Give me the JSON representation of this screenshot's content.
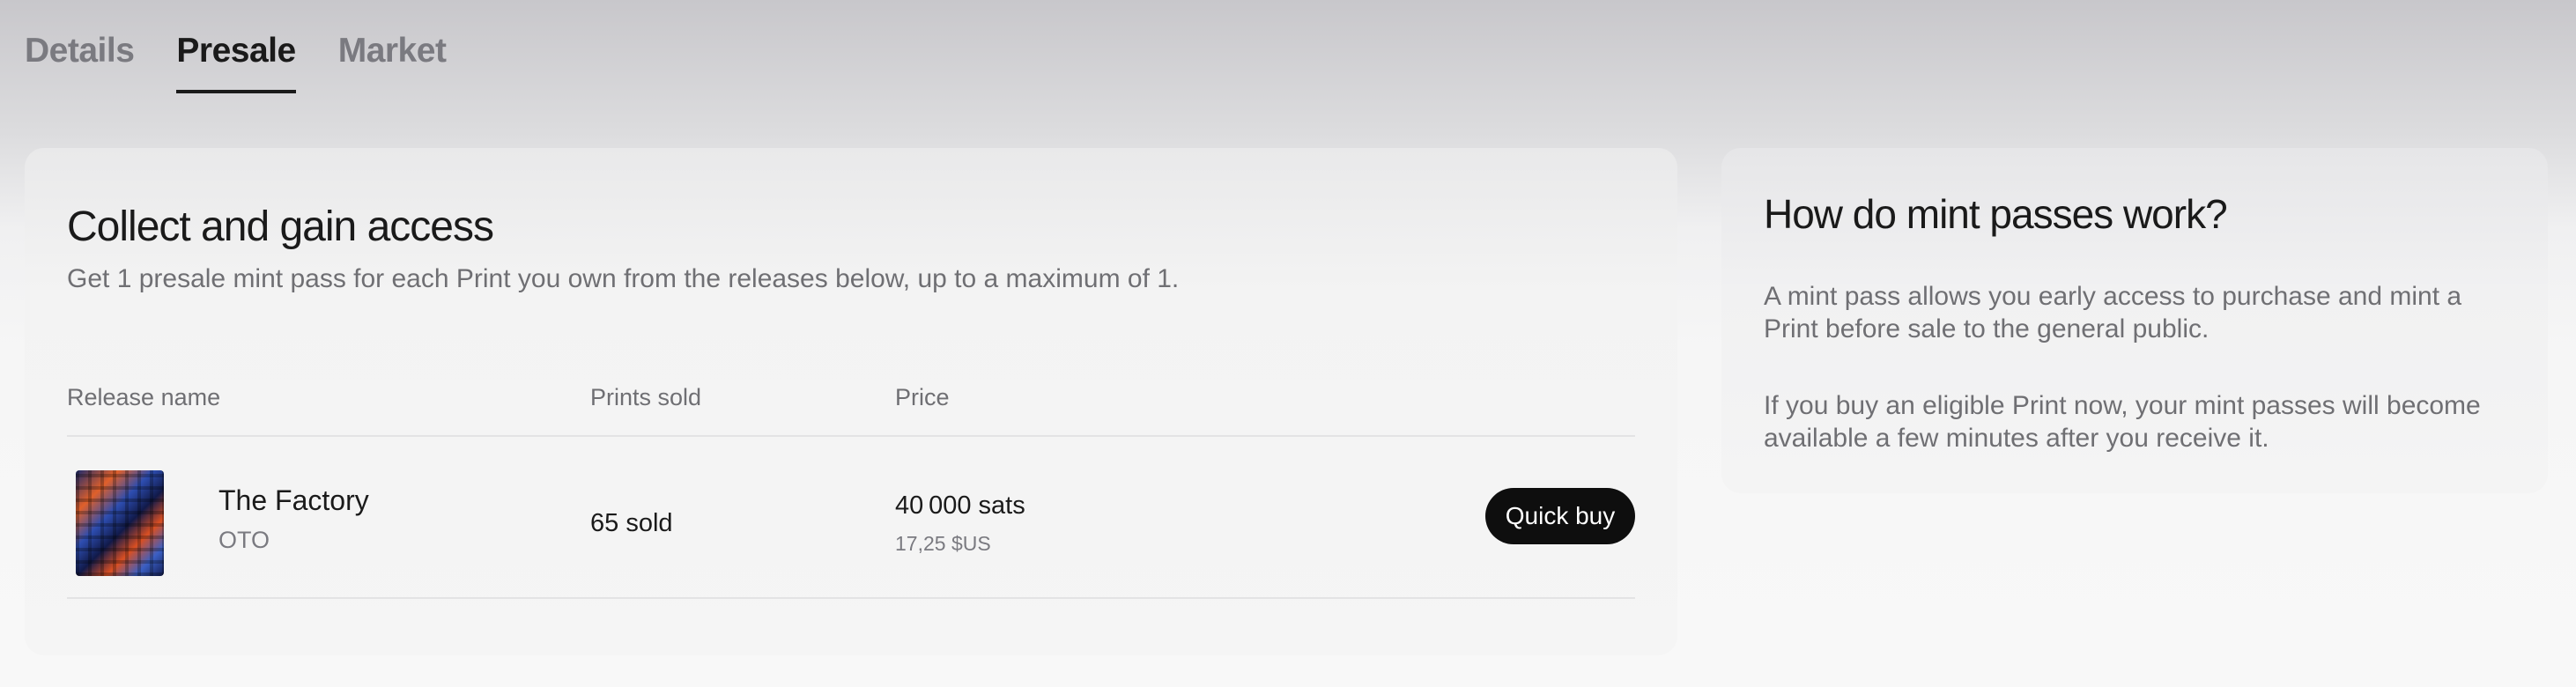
{
  "tabs": [
    {
      "label": "Details",
      "active": false
    },
    {
      "label": "Presale",
      "active": true
    },
    {
      "label": "Market",
      "active": false
    }
  ],
  "presale": {
    "title": "Collect and gain access",
    "subtitle": "Get 1 presale mint pass for each Print you own from the releases below, up to a maximum of 1.",
    "columns": [
      "Release name",
      "Prints sold",
      "Price"
    ],
    "releases": [
      {
        "name": "The Factory",
        "artist": "OTO",
        "sold": "65 sold",
        "price": "40 000 sats",
        "price_usd": "17,25 $US",
        "action": "Quick buy"
      }
    ]
  },
  "info": {
    "title": "How do mint passes work?",
    "paragraphs": [
      "A mint pass allows you early access to purchase and mint a Print before sale to the general public.",
      "If you buy an eligible Print now, your mint passes will become available a few minutes after you receive it."
    ]
  },
  "colors": {
    "button_bg": "#0e0e0e",
    "text_primary": "#1a1a1a",
    "text_muted": "#6f6f73"
  }
}
